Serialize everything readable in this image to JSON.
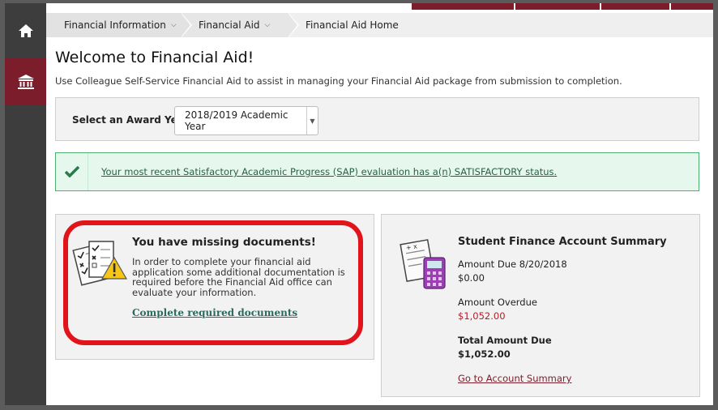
{
  "colors": {
    "nav_bg": "#3d3d3d",
    "nav_active": "#7b1d2b",
    "success_bg": "#e6f8ee",
    "success_border": "#4caf6e",
    "alert_red": "#e0141a",
    "money_red": "#b3202b"
  },
  "nav": {
    "items": [
      {
        "icon": "home-icon"
      },
      {
        "icon": "bank-icon"
      }
    ]
  },
  "breadcrumb": {
    "items": [
      {
        "label": "Financial Information"
      },
      {
        "label": "Financial Aid"
      },
      {
        "label": "Financial Aid Home"
      }
    ]
  },
  "page": {
    "title": "Welcome to Financial Aid!",
    "intro": "Use Colleague Self-Service Financial Aid to assist in managing your Financial Aid package from submission to completion."
  },
  "award_year": {
    "label": "Select an Award Year:",
    "selected": "2018/2019 Academic Year"
  },
  "sap": {
    "message": "Your most recent Satisfactory Academic Progress (SAP) evaluation has a(n) SATISFACTORY status."
  },
  "documents": {
    "title": "You have missing documents!",
    "text": "In order to complete your financial aid application some additional documentation is required before the Financial Aid office can evaluate your information.",
    "link": "Complete required documents"
  },
  "finance": {
    "title": "Student Finance Account Summary",
    "amount_due_label": "Amount Due 8/20/2018",
    "amount_due_value": "$0.00",
    "overdue_label": "Amount Overdue",
    "overdue_value": "$1,052.00",
    "total_label": "Total Amount Due",
    "total_value": "$1,052.00",
    "link": "Go to Account Summary"
  }
}
